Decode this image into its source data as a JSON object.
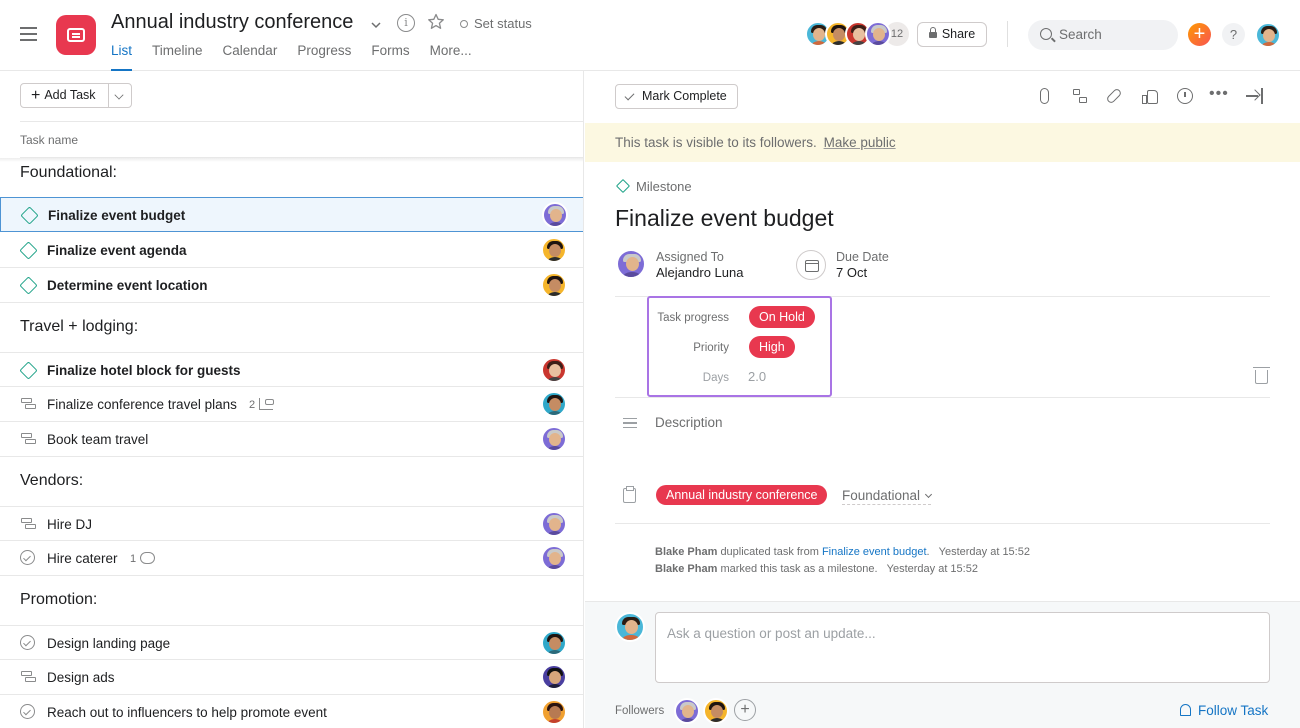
{
  "header": {
    "project_title": "Annual industry conference",
    "set_status": "Set status",
    "tabs": [
      "List",
      "Timeline",
      "Calendar",
      "Progress",
      "Forms",
      "More..."
    ],
    "member_count": "12",
    "share_label": "Share",
    "search_placeholder": "Search",
    "add_label": "+",
    "help_label": "?",
    "brand_color": "#e8384f",
    "accent_color": "#1575c5"
  },
  "list": {
    "add_task_label": "Add Task",
    "column_header": "Task name",
    "sections": [
      {
        "title": "Foundational:",
        "tasks": [
          {
            "name": "Finalize event budget",
            "icon": "milestone-diamond-icon",
            "bold": true,
            "selected": true
          },
          {
            "name": "Finalize event agenda",
            "icon": "milestone-diamond-icon",
            "bold": true
          },
          {
            "name": "Determine event location",
            "icon": "milestone-diamond-icon",
            "bold": true
          }
        ]
      },
      {
        "title": "Travel + lodging:",
        "tasks": [
          {
            "name": "Finalize hotel block for guests",
            "icon": "milestone-diamond-icon",
            "bold": true
          },
          {
            "name": "Finalize conference travel plans",
            "icon": "subtask-icon",
            "subtask_count": "2"
          },
          {
            "name": "Book team travel",
            "icon": "subtask-icon"
          }
        ]
      },
      {
        "title": "Vendors:",
        "tasks": [
          {
            "name": "Hire DJ",
            "icon": "subtask-icon"
          },
          {
            "name": "Hire caterer",
            "icon": "check-circle-icon",
            "comment_count": "1"
          }
        ]
      },
      {
        "title": "Promotion:",
        "tasks": [
          {
            "name": "Design landing page",
            "icon": "check-circle-icon"
          },
          {
            "name": "Design ads",
            "icon": "subtask-icon"
          },
          {
            "name": "Reach out to influencers to help promote event",
            "icon": "check-circle-icon"
          }
        ]
      }
    ]
  },
  "detail": {
    "mark_complete_label": "Mark Complete",
    "visibility_text": "This task is visible to its followers.",
    "make_public_label": "Make public",
    "type_label": "Milestone",
    "title": "Finalize event budget",
    "assigned_to_label": "Assigned To",
    "assignee": "Alejandro Luna",
    "due_date_label": "Due Date",
    "due_date": "7 Oct",
    "custom_fields": {
      "task_progress_label": "Task progress",
      "task_progress_value": "On Hold",
      "priority_label": "Priority",
      "priority_value": "High",
      "days_label": "Days",
      "days_value": "2.0",
      "pill_color": "#e8384f"
    },
    "description_placeholder": "Description",
    "project_pill": "Annual industry conference",
    "section_value": "Foundational",
    "activity": [
      {
        "user": "Blake Pham",
        "text": "duplicated task from",
        "link": "Finalize event budget",
        "suffix": ".",
        "time": "Yesterday at 15:52"
      },
      {
        "user": "Blake Pham",
        "text": "marked this task as a milestone.",
        "time": "Yesterday at 15:52"
      }
    ],
    "comment_placeholder": "Ask a question or post an update...",
    "followers_label": "Followers",
    "follow_task_label": "Follow Task"
  }
}
